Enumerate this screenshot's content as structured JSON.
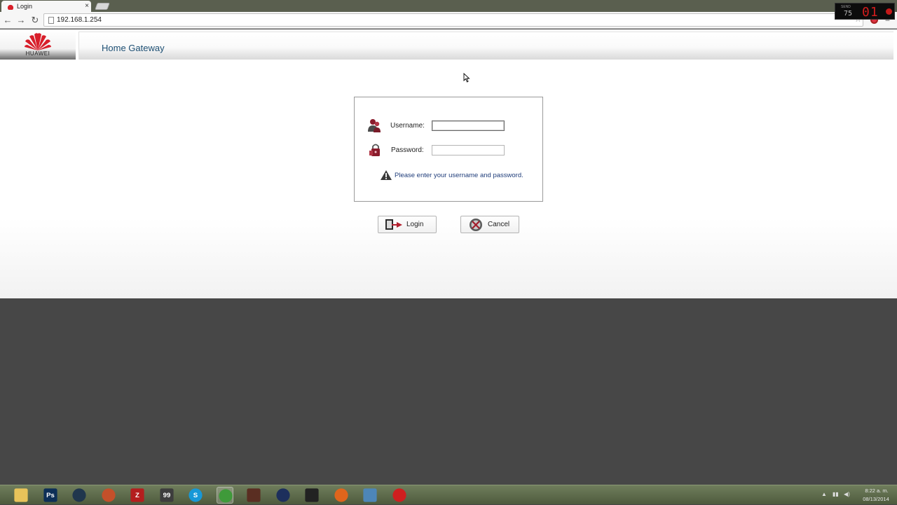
{
  "browser": {
    "tab_title": "Login",
    "tab_close": "×",
    "url": "192.168.1.254",
    "back": "←",
    "forward": "→",
    "reload": "↻",
    "star": "☆",
    "menu": "≡"
  },
  "recorder": {
    "label": "SEND",
    "small_count": "75",
    "count": "01"
  },
  "header": {
    "brand": "HUAWEI",
    "title": "Home Gateway"
  },
  "login": {
    "username_label": "Username:",
    "username_value": "",
    "password_label": "Password:",
    "password_value": "",
    "message": "Please enter your username and password.",
    "login_button": "Login",
    "cancel_button": "Cancel"
  },
  "taskbar": {
    "apps": [
      {
        "name": "file-explorer-icon",
        "glyph": "",
        "color": "#e8c35a"
      },
      {
        "name": "photoshop-icon",
        "glyph": "Ps",
        "color": "#0d2f57"
      },
      {
        "name": "steam-icon",
        "glyph": "",
        "color": "#20364d"
      },
      {
        "name": "app-orange-icon",
        "glyph": "",
        "color": "#c4502a"
      },
      {
        "name": "filezilla-icon",
        "glyph": "Z",
        "color": "#b41e1e"
      },
      {
        "name": "app-dark-icon",
        "glyph": "99",
        "color": "#3d3d3d"
      },
      {
        "name": "skype-icon",
        "glyph": "S",
        "color": "#1798d7"
      },
      {
        "name": "chrome-icon",
        "glyph": "",
        "color": "#3f9a3a"
      },
      {
        "name": "game-icon",
        "glyph": "",
        "color": "#5a2e22"
      },
      {
        "name": "cinema4d-icon",
        "glyph": "",
        "color": "#1d2f5c"
      },
      {
        "name": "unity-icon",
        "glyph": "",
        "color": "#222222"
      },
      {
        "name": "firefox-icon",
        "glyph": "",
        "color": "#e0651c"
      },
      {
        "name": "app-blue-icon",
        "glyph": "",
        "color": "#4d86b8"
      },
      {
        "name": "record-icon",
        "glyph": "",
        "color": "#cf1f1f"
      }
    ],
    "clock_time": "8:22 a. m.",
    "clock_date": "08/13/2014"
  }
}
